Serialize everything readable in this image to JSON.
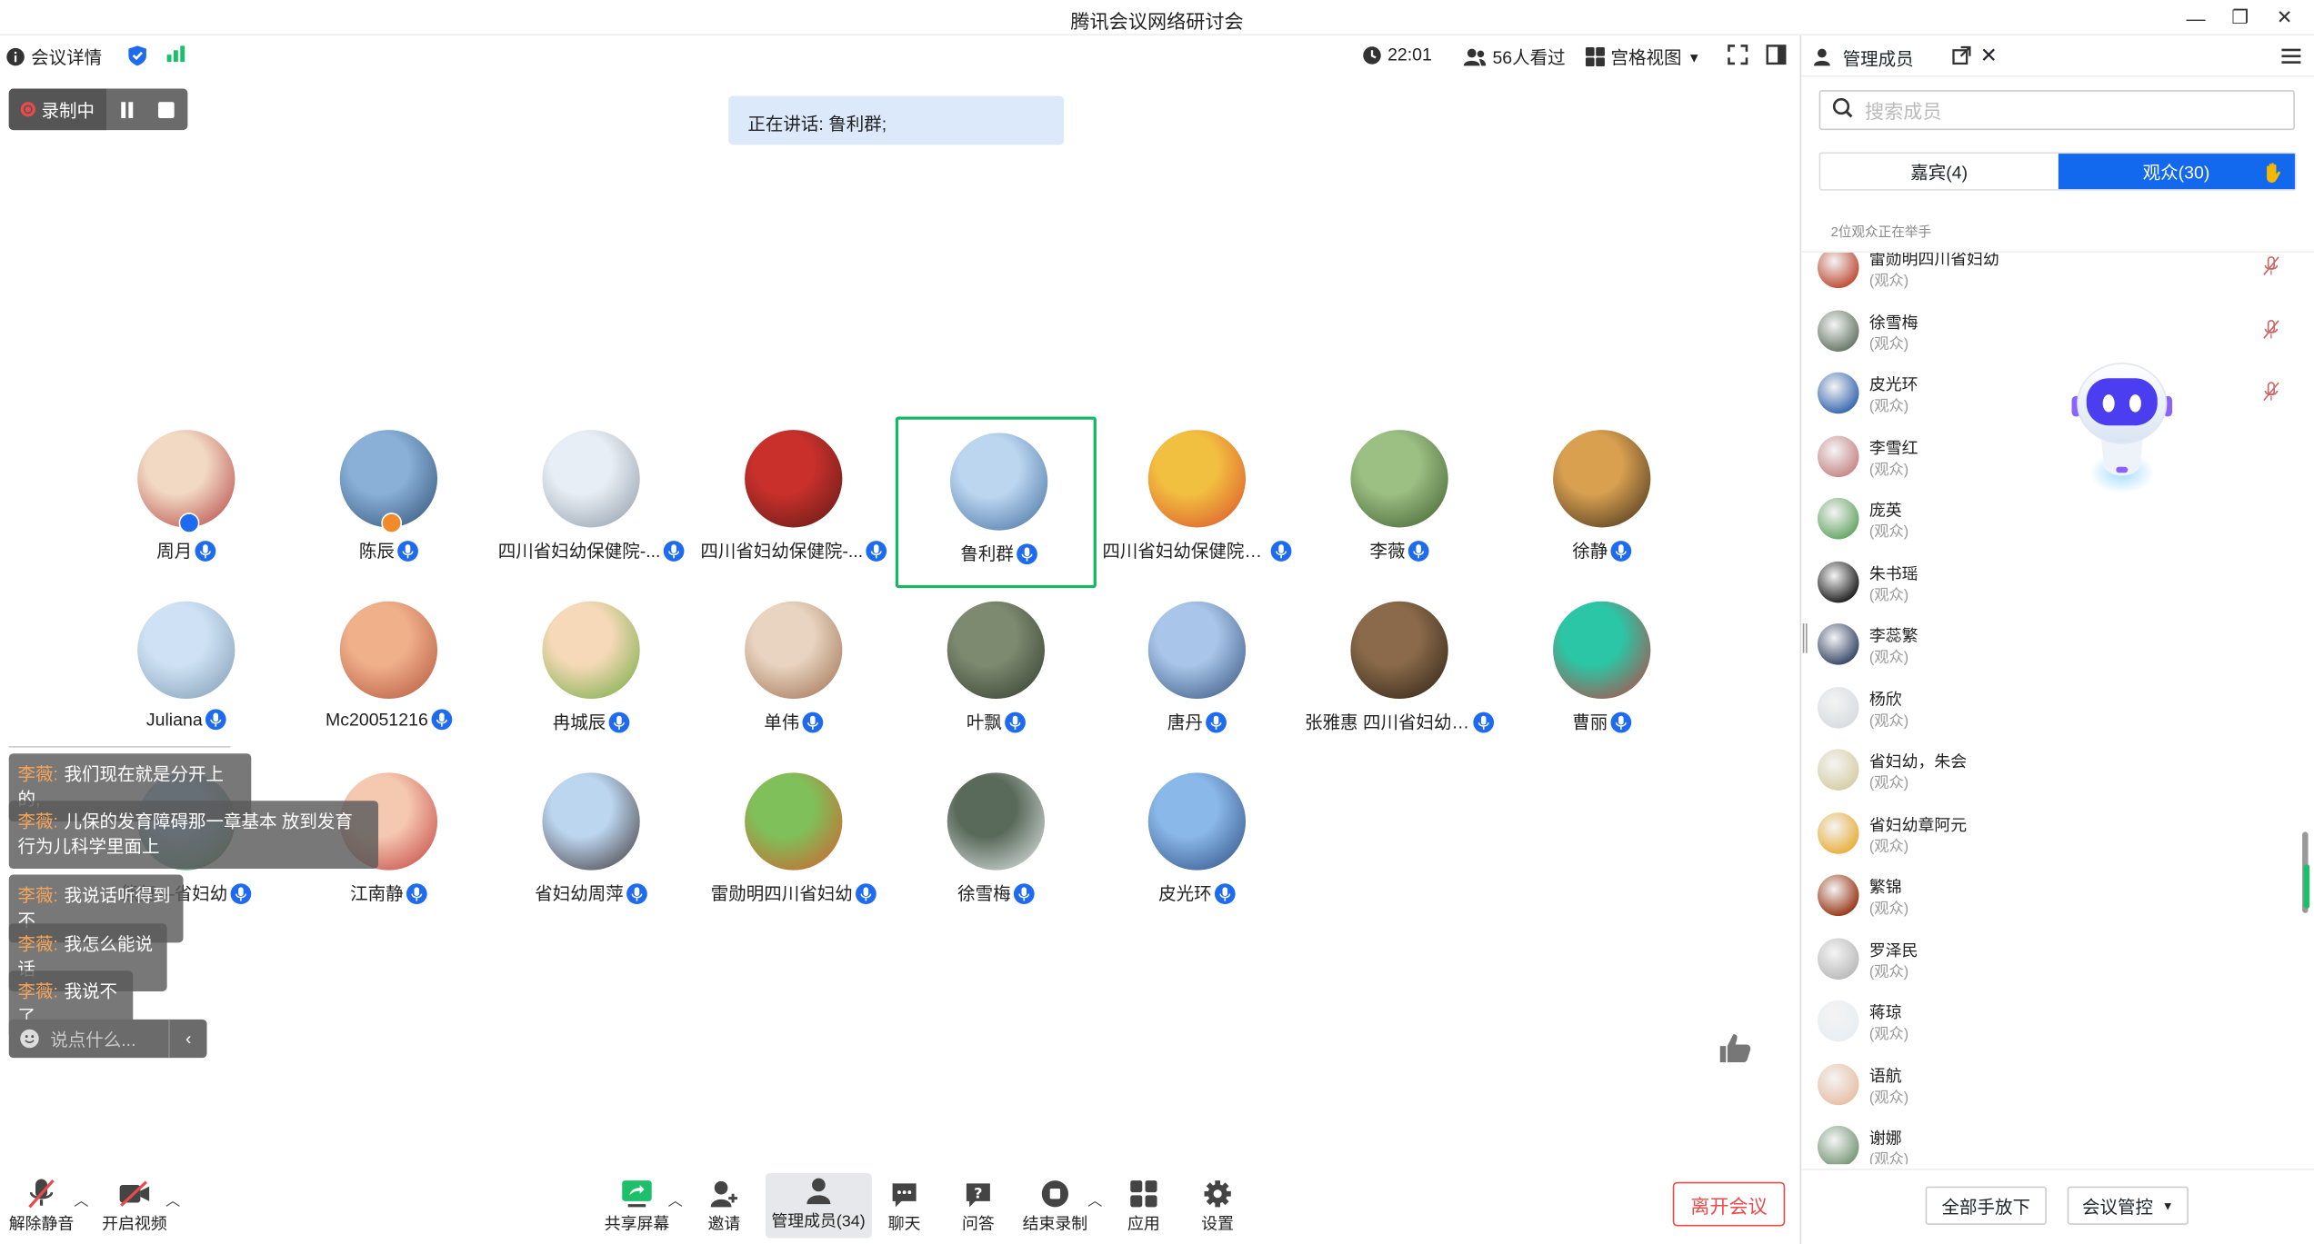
{
  "window": {
    "title": "腾讯会议网络研讨会"
  },
  "topbar": {
    "meeting_info": "会议详情",
    "clock": "22:01",
    "viewers": "56人看过",
    "view_mode": "宫格视图"
  },
  "recording": {
    "label": "录制中"
  },
  "speaking": "正在讲话: 鲁利群;",
  "participants": [
    {
      "name": "周月"
    },
    {
      "name": "陈辰"
    },
    {
      "name": "四川省妇幼保健院-..."
    },
    {
      "name": "四川省妇幼保健院-..."
    },
    {
      "name": "鲁利群"
    },
    {
      "name": "四川省妇幼保健院熊..."
    },
    {
      "name": "李薇"
    },
    {
      "name": "徐静"
    },
    {
      "name": "Juliana"
    },
    {
      "name": "Mc20051216"
    },
    {
      "name": "冉城辰"
    },
    {
      "name": "单伟"
    },
    {
      "name": "叶飘"
    },
    {
      "name": "唐丹"
    },
    {
      "name": "张雅惠 四川省妇幼保健院"
    },
    {
      "name": "曹丽"
    },
    {
      "name": "熊复—省妇幼"
    },
    {
      "name": "江南静"
    },
    {
      "name": "省妇幼周萍"
    },
    {
      "name": "雷勋明四川省妇幼"
    },
    {
      "name": "徐雪梅"
    },
    {
      "name": "皮光环"
    }
  ],
  "chat": {
    "messages": [
      {
        "speaker": "李薇:",
        "text": "我们现在就是分开上的,"
      },
      {
        "speaker": "李薇:",
        "text": "儿保的发育障碍那一章基本 放到发育行为儿科学里面上"
      },
      {
        "speaker": "李薇:",
        "text": "我说话听得到不"
      },
      {
        "speaker": "李薇:",
        "text": "我怎么能说话"
      },
      {
        "speaker": "李薇:",
        "text": "我说不了"
      }
    ],
    "placeholder": "说点什么..."
  },
  "toolbar": {
    "unmute": "解除静音",
    "video": "开启视频",
    "share": "共享屏幕",
    "invite": "邀请",
    "manage": "管理成员(34)",
    "chat": "聊天",
    "qa": "问答",
    "end_record": "结束录制",
    "apps": "应用",
    "settings": "设置",
    "leave": "离开会议"
  },
  "panel": {
    "title": "管理成员",
    "search_placeholder": "搜索成员",
    "tab_guests": "嘉宾(4)",
    "tab_audience": "观众(30)",
    "raise_note": "2位观众正在举手",
    "members": [
      {
        "name": "雷勋明四川省妇幼",
        "role": "(观众)"
      },
      {
        "name": "徐雪梅",
        "role": "(观众)"
      },
      {
        "name": "皮光环",
        "role": "(观众)"
      },
      {
        "name": "李雪红",
        "role": "(观众)"
      },
      {
        "name": "庞英",
        "role": "(观众)"
      },
      {
        "name": "朱书瑶",
        "role": "(观众)"
      },
      {
        "name": "李蕊繁",
        "role": "(观众)"
      },
      {
        "name": "杨欣",
        "role": "(观众)"
      },
      {
        "name": "省妇幼，朱会",
        "role": "(观众)"
      },
      {
        "name": "省妇幼章阿元",
        "role": "(观众)"
      },
      {
        "name": "繁锦",
        "role": "(观众)"
      },
      {
        "name": "罗泽民",
        "role": "(观众)"
      },
      {
        "name": "蒋琼",
        "role": "(观众)"
      },
      {
        "name": "语航",
        "role": "(观众)"
      },
      {
        "name": "谢娜",
        "role": "(观众)"
      }
    ],
    "lower_all": "全部手放下",
    "control": "会议管控"
  },
  "colors": {
    "accent": "#1269ee",
    "active_border": "#18b566",
    "danger": "#e84b4b"
  }
}
